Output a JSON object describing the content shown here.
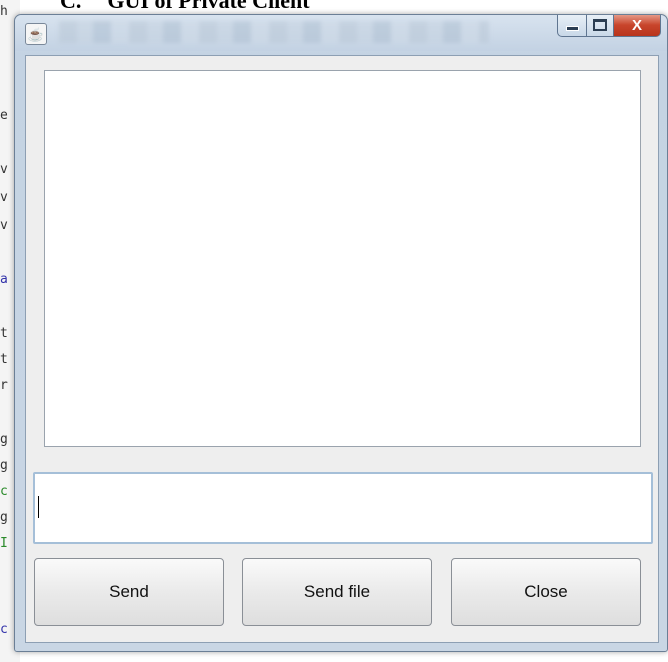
{
  "caption": {
    "number": "C.",
    "text": "GUI of Private Client"
  },
  "background_code": {
    "chars": [
      "h",
      "e",
      "v",
      "v",
      "v",
      "a",
      "t",
      "t",
      "r",
      "g",
      "g",
      "c",
      "g",
      "I",
      "c"
    ]
  },
  "window": {
    "icon": "java-coffee-cup-icon",
    "controls": {
      "minimize": "minimize-icon",
      "maximize": "maximize-icon",
      "close_glyph": "X"
    }
  },
  "chat_area": {
    "content": ""
  },
  "message_input": {
    "value": ""
  },
  "buttons": {
    "send": "Send",
    "send_file": "Send file",
    "close": "Close"
  },
  "colors": {
    "title_bar": "#c8d6e5",
    "close_button": "#c8452c",
    "client_background": "#eeeeee"
  }
}
